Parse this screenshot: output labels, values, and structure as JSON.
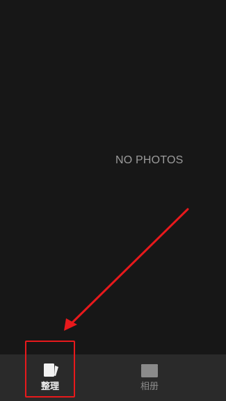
{
  "gallery": {
    "empty_text": "NO PHOTOS"
  },
  "tabbar": {
    "tabs": [
      {
        "label": "整理",
        "icon": "organize-cards-icon",
        "selected": true
      },
      {
        "label": "相册",
        "icon": "album-folder-icon",
        "selected": false
      }
    ]
  },
  "colors": {
    "background": "#171717",
    "tabbar_background": "#2a2a2a",
    "selected_text": "#f2f2f2",
    "unselected_text": "#8c8c8c",
    "annotation_red": "#e8191c"
  }
}
